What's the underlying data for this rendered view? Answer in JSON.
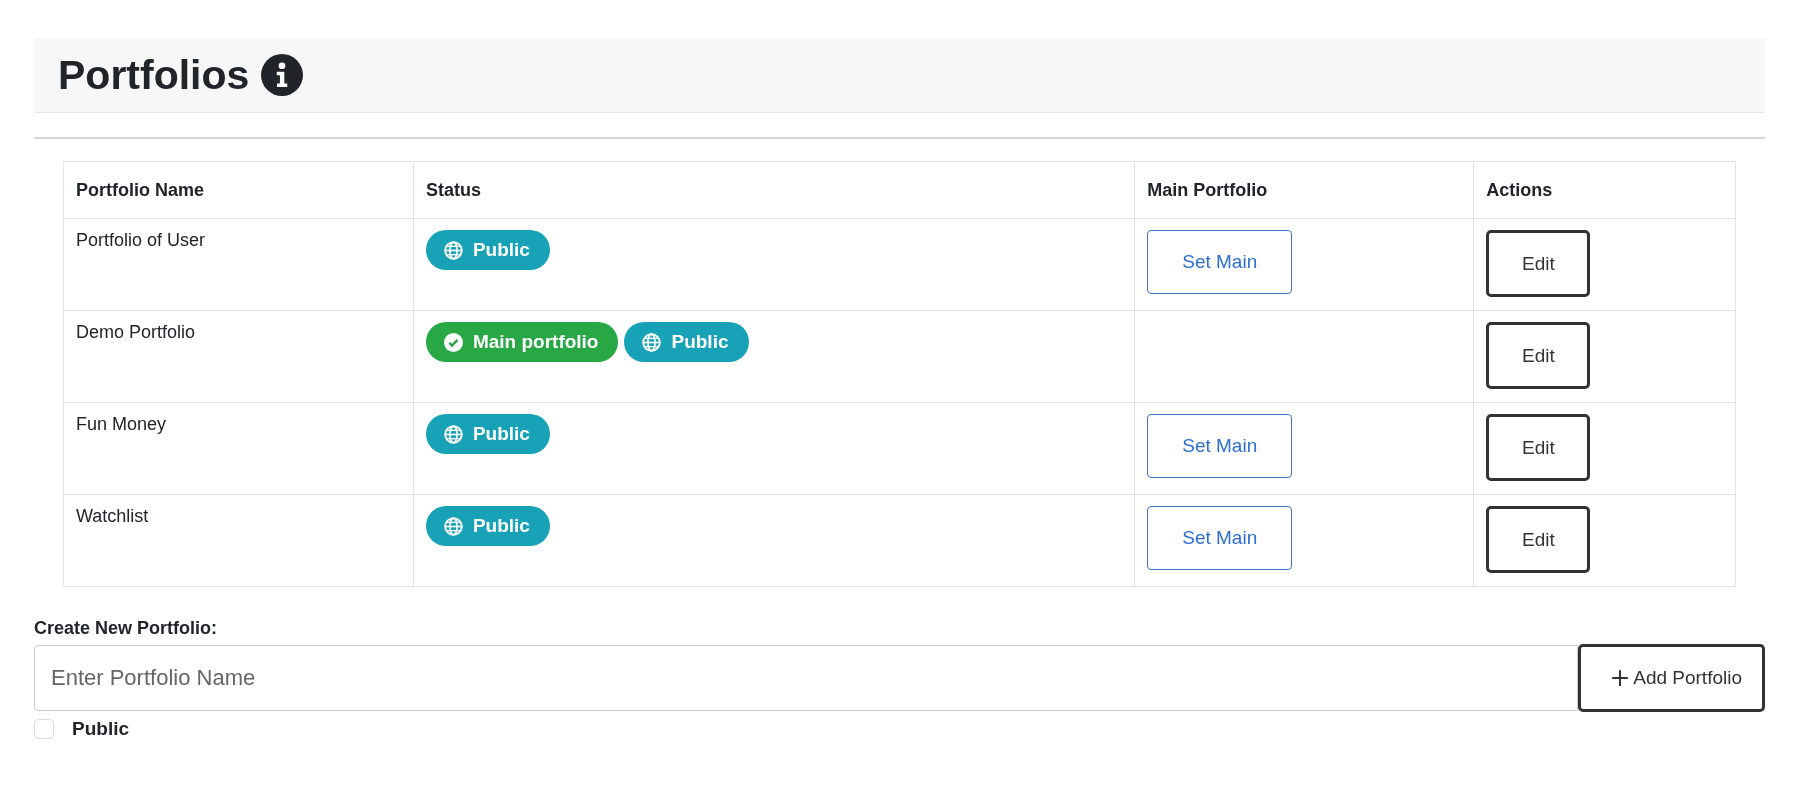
{
  "header": {
    "title": "Portfolios"
  },
  "table": {
    "columns": [
      "Portfolio Name",
      "Status",
      "Main Portfolio",
      "Actions"
    ],
    "rows": [
      {
        "name": "Portfolio of User",
        "badges": [
          {
            "kind": "public",
            "label": "Public",
            "color": "#17a2b8"
          }
        ],
        "main_button": "Set Main",
        "action": "Edit"
      },
      {
        "name": "Demo Portfolio",
        "badges": [
          {
            "kind": "main",
            "label": "Main portfolio",
            "color": "#28a745"
          },
          {
            "kind": "public",
            "label": "Public",
            "color": "#17a2b8"
          }
        ],
        "action": "Edit"
      },
      {
        "name": "Fun Money",
        "badges": [
          {
            "kind": "public",
            "label": "Public",
            "color": "#17a2b8"
          }
        ],
        "main_button": "Set Main",
        "action": "Edit"
      },
      {
        "name": "Watchlist",
        "badges": [
          {
            "kind": "public",
            "label": "Public",
            "color": "#17a2b8"
          }
        ],
        "main_button": "Set Main",
        "action": "Edit"
      }
    ]
  },
  "create_form": {
    "label": "Create New Portfolio:",
    "placeholder": "Enter Portfolio Name",
    "button": "Add Portfolio",
    "public_checkbox": {
      "label": "Public",
      "checked": false
    }
  }
}
